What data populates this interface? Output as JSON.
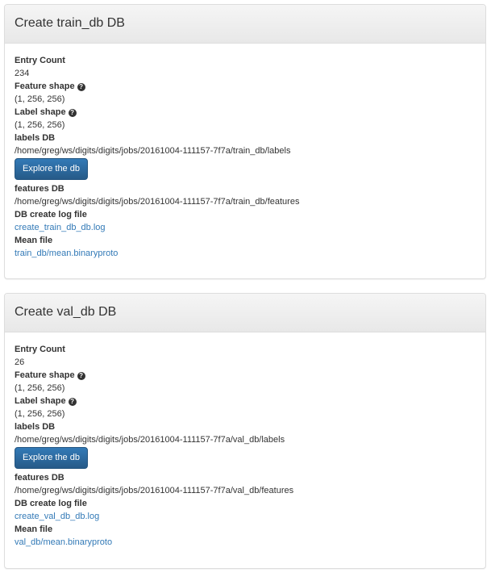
{
  "panels": [
    {
      "title": "Create train_db DB",
      "entry_count_label": "Entry Count",
      "entry_count": "234",
      "feature_shape_label": "Feature shape",
      "feature_shape": "(1, 256, 256)",
      "label_shape_label": "Label shape",
      "label_shape": "(1, 256, 256)",
      "labels_db_label": "labels DB",
      "labels_db_path": "/home/greg/ws/digits/digits/jobs/20161004-111157-7f7a/train_db/labels",
      "explore_button": "Explore the db",
      "features_db_label": "features DB",
      "features_db_path": "/home/greg/ws/digits/digits/jobs/20161004-111157-7f7a/train_db/features",
      "log_label": "DB create log file",
      "log_link": "create_train_db_db.log",
      "mean_label": "Mean file",
      "mean_link": "train_db/mean.binaryproto"
    },
    {
      "title": "Create val_db DB",
      "entry_count_label": "Entry Count",
      "entry_count": "26",
      "feature_shape_label": "Feature shape",
      "feature_shape": "(1, 256, 256)",
      "label_shape_label": "Label shape",
      "label_shape": "(1, 256, 256)",
      "labels_db_label": "labels DB",
      "labels_db_path": "/home/greg/ws/digits/digits/jobs/20161004-111157-7f7a/val_db/labels",
      "explore_button": "Explore the db",
      "features_db_label": "features DB",
      "features_db_path": "/home/greg/ws/digits/digits/jobs/20161004-111157-7f7a/val_db/features",
      "log_label": "DB create log file",
      "log_link": "create_val_db_db.log",
      "mean_label": "Mean file",
      "mean_link": "val_db/mean.binaryproto"
    }
  ],
  "icons": {
    "help": "question-circle-icon"
  },
  "colors": {
    "link": "#337ab7",
    "button": "#337ab7",
    "heading_bg": "#f5f5f5"
  }
}
